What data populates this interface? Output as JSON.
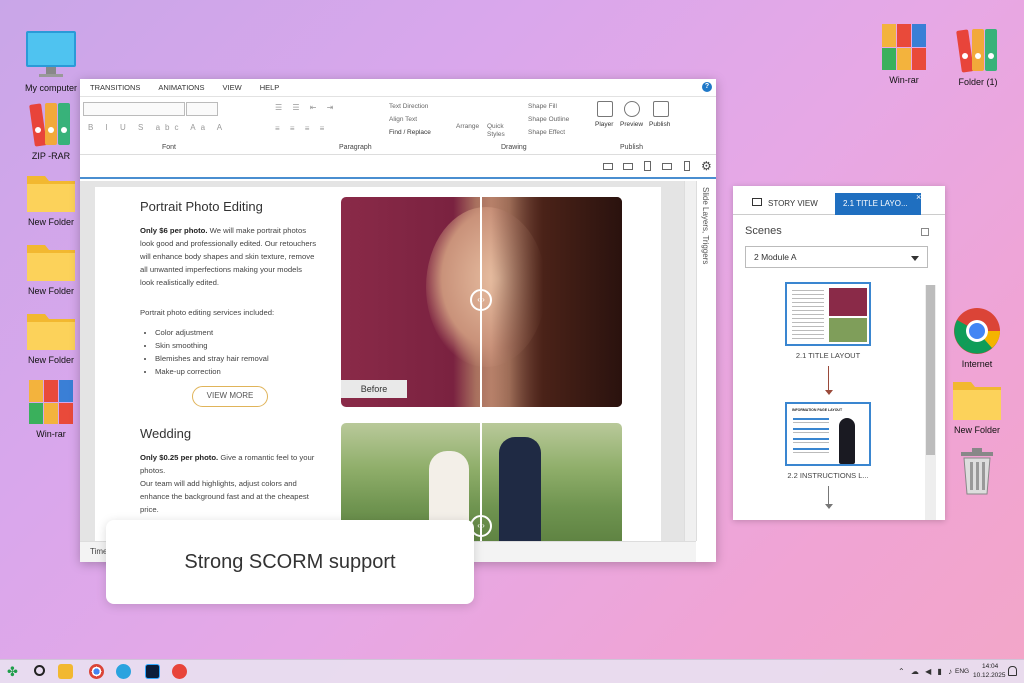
{
  "desktop_left": [
    {
      "label": "My computer",
      "icon": "monitor-icon"
    },
    {
      "label": "ZIP -RAR",
      "icon": "archive-icon"
    },
    {
      "label": "New Folder",
      "icon": "folder-icon"
    },
    {
      "label": "New Folder",
      "icon": "folder-icon"
    },
    {
      "label": "New Folder",
      "icon": "folder-icon"
    },
    {
      "label": "Win-rar",
      "icon": "archive-icon"
    }
  ],
  "desktop_right": [
    {
      "label": "Win-rar",
      "icon": "archive-icon"
    },
    {
      "label": "Folder (1)",
      "icon": "archive-icon"
    },
    {
      "label": "Internet",
      "icon": "chrome-icon"
    },
    {
      "label": "New Folder",
      "icon": "folder-icon"
    },
    {
      "label": "",
      "icon": "trash-icon"
    }
  ],
  "app": {
    "menu": [
      "TRANSITIONS",
      "ANIMATIONS",
      "VIEW",
      "HELP"
    ],
    "help_label": "?",
    "ribbon": {
      "font_group": "Font",
      "paragraph_group": "Paragraph",
      "drawing_group": "Drawing",
      "publish_group": "Publish",
      "text_direction": "Text Direction",
      "align_text": "Align Text",
      "find_replace": "Find / Replace",
      "arrange": "Arrange",
      "quick_styles": "Quick Styles",
      "shape_fill": "Shape Fill",
      "shape_outline": "Shape Outline",
      "shape_effect": "Shape Effect",
      "player": "Player",
      "preview": "Preview",
      "publish": "Publish"
    },
    "side_tab": "Slide Layers, Triggers",
    "bottom_label": "Timeline",
    "slide": {
      "s1_title": "Portrait Photo Editing",
      "s1_price": "Only $6 per photo.",
      "s1_body": "We will make portrait photos look good and professionally edited. Our retouchers will enhance body shapes and skin texture, remove all unwanted imperfections making your models look realistically edited.",
      "s1_list_intro": "Portrait photo editing services included:",
      "s1_list": [
        "Color adjustment",
        "Skin smoothing",
        "Blemishes and stray hair removal",
        "Make-up correction"
      ],
      "view_more": "VIEW MORE",
      "before_label": "Before",
      "s2_title": "Wedding",
      "s2_price": "Only $0.25 per photo.",
      "s2_body1": "Give a romantic feel to your photos.",
      "s2_body2": "Our team will add highlights, adjust colors and enhance the background fast and at the cheapest price."
    }
  },
  "story_panel": {
    "tab_story": "STORY VIEW",
    "tab_active": "2.1 TITLE LAYO...",
    "close": "×",
    "scenes_label": "Scenes",
    "scene_select": "2 Module A",
    "thumb1_label": "2.1 TITLE LAYOUT",
    "thumb2_label": "2.2 INSTRUCTIONS L...",
    "thumb2_heading": "INFORMATION PAGE LAYOUT"
  },
  "toast": "Strong SCORM support",
  "taskbar": {
    "lang": "ENG",
    "time": "14:04",
    "date": "10.12.2025"
  },
  "colors": {
    "accent": "#1f6fc0",
    "button_border": "#e0b45a"
  }
}
